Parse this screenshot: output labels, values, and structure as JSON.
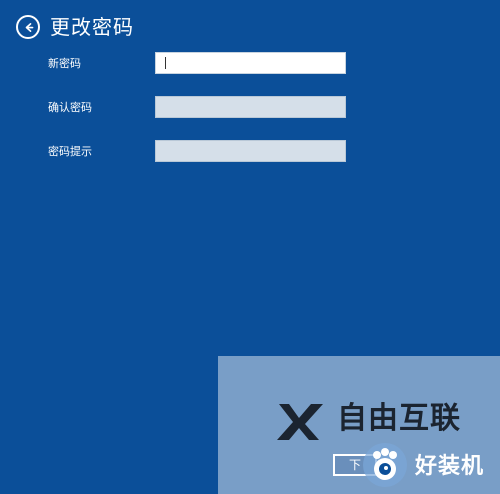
{
  "header": {
    "title": "更改密码",
    "back_icon": "back-arrow-icon"
  },
  "form": {
    "fields": [
      {
        "label": "新密码",
        "value": "",
        "state": "active"
      },
      {
        "label": "确认密码",
        "value": "",
        "state": "inactive"
      },
      {
        "label": "密码提示",
        "value": "",
        "state": "inactive"
      }
    ]
  },
  "overlay": {
    "brand_text": "自由互联",
    "next_button_label": "下",
    "site_text": "好装机"
  },
  "colors": {
    "background": "#0b4f99",
    "input_active": "#ffffff",
    "input_inactive": "#d5dfe9",
    "text": "#ffffff"
  }
}
